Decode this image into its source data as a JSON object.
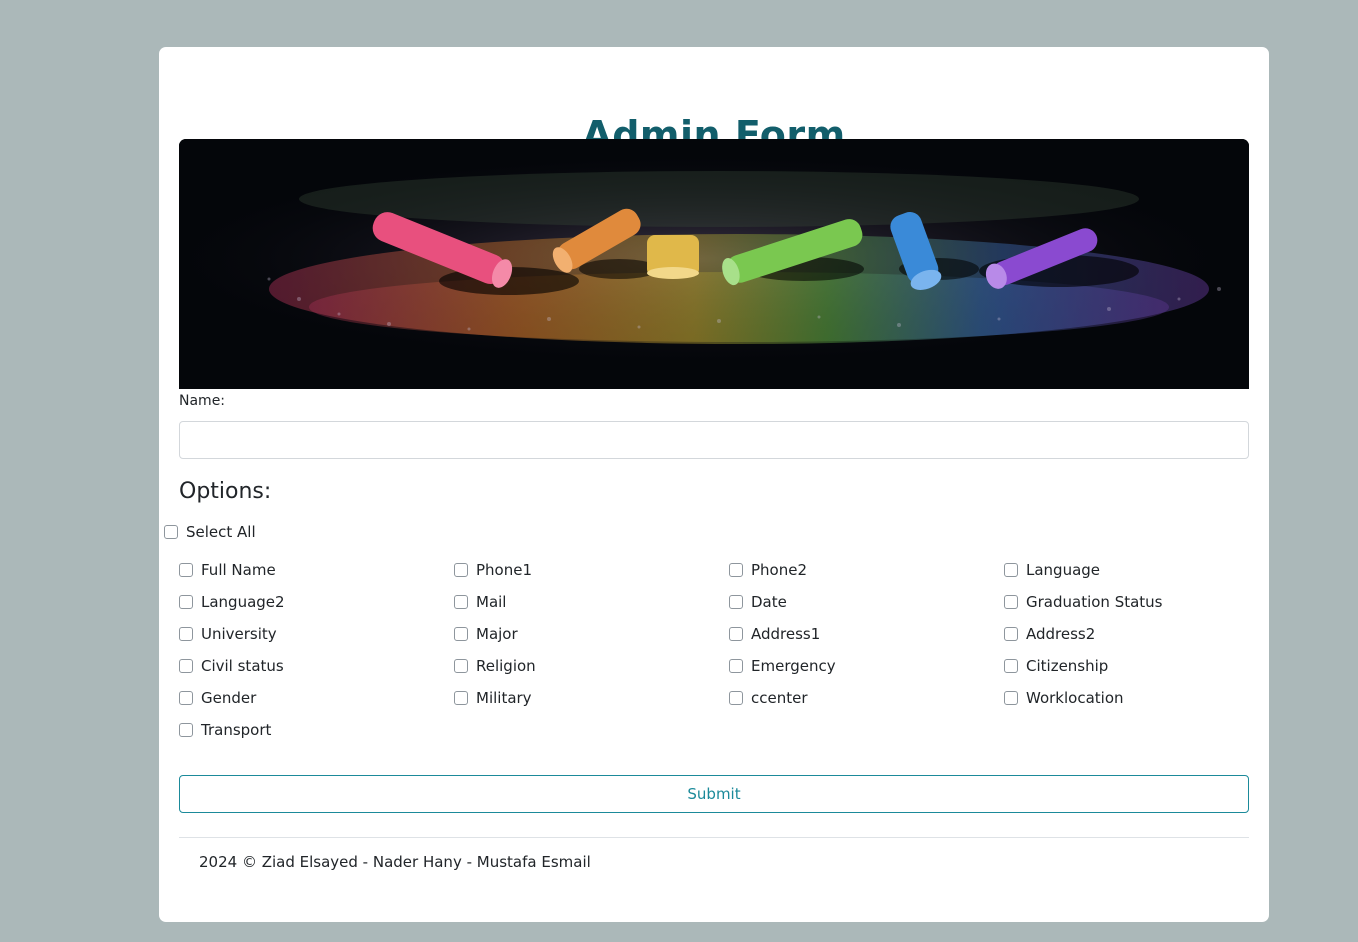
{
  "form": {
    "title": "Admin Form",
    "name_label": "Name:",
    "name_value": "",
    "options_title": "Options:",
    "select_all_label": "Select All",
    "submit_label": "Submit"
  },
  "options": [
    "Full Name",
    "Phone1",
    "Phone2",
    "Language",
    "Language2",
    "Mail",
    "Date",
    "Graduation Status",
    "University",
    "Major",
    "Address1",
    "Address2",
    "Civil status",
    "Religion",
    "Emergency",
    "Citizenship",
    "Gender",
    "Military",
    "ccenter",
    "Worklocation",
    "Transport"
  ],
  "footer": {
    "text": "2024 © Ziad Elsayed - Nader Hany - Mustafa Esmail"
  },
  "colors": {
    "page_background": "#abb8b9",
    "title": "#125e6b",
    "accent": "#1b8a9a"
  },
  "banner": {
    "image_subject": "colorful-chalk-sticks"
  }
}
